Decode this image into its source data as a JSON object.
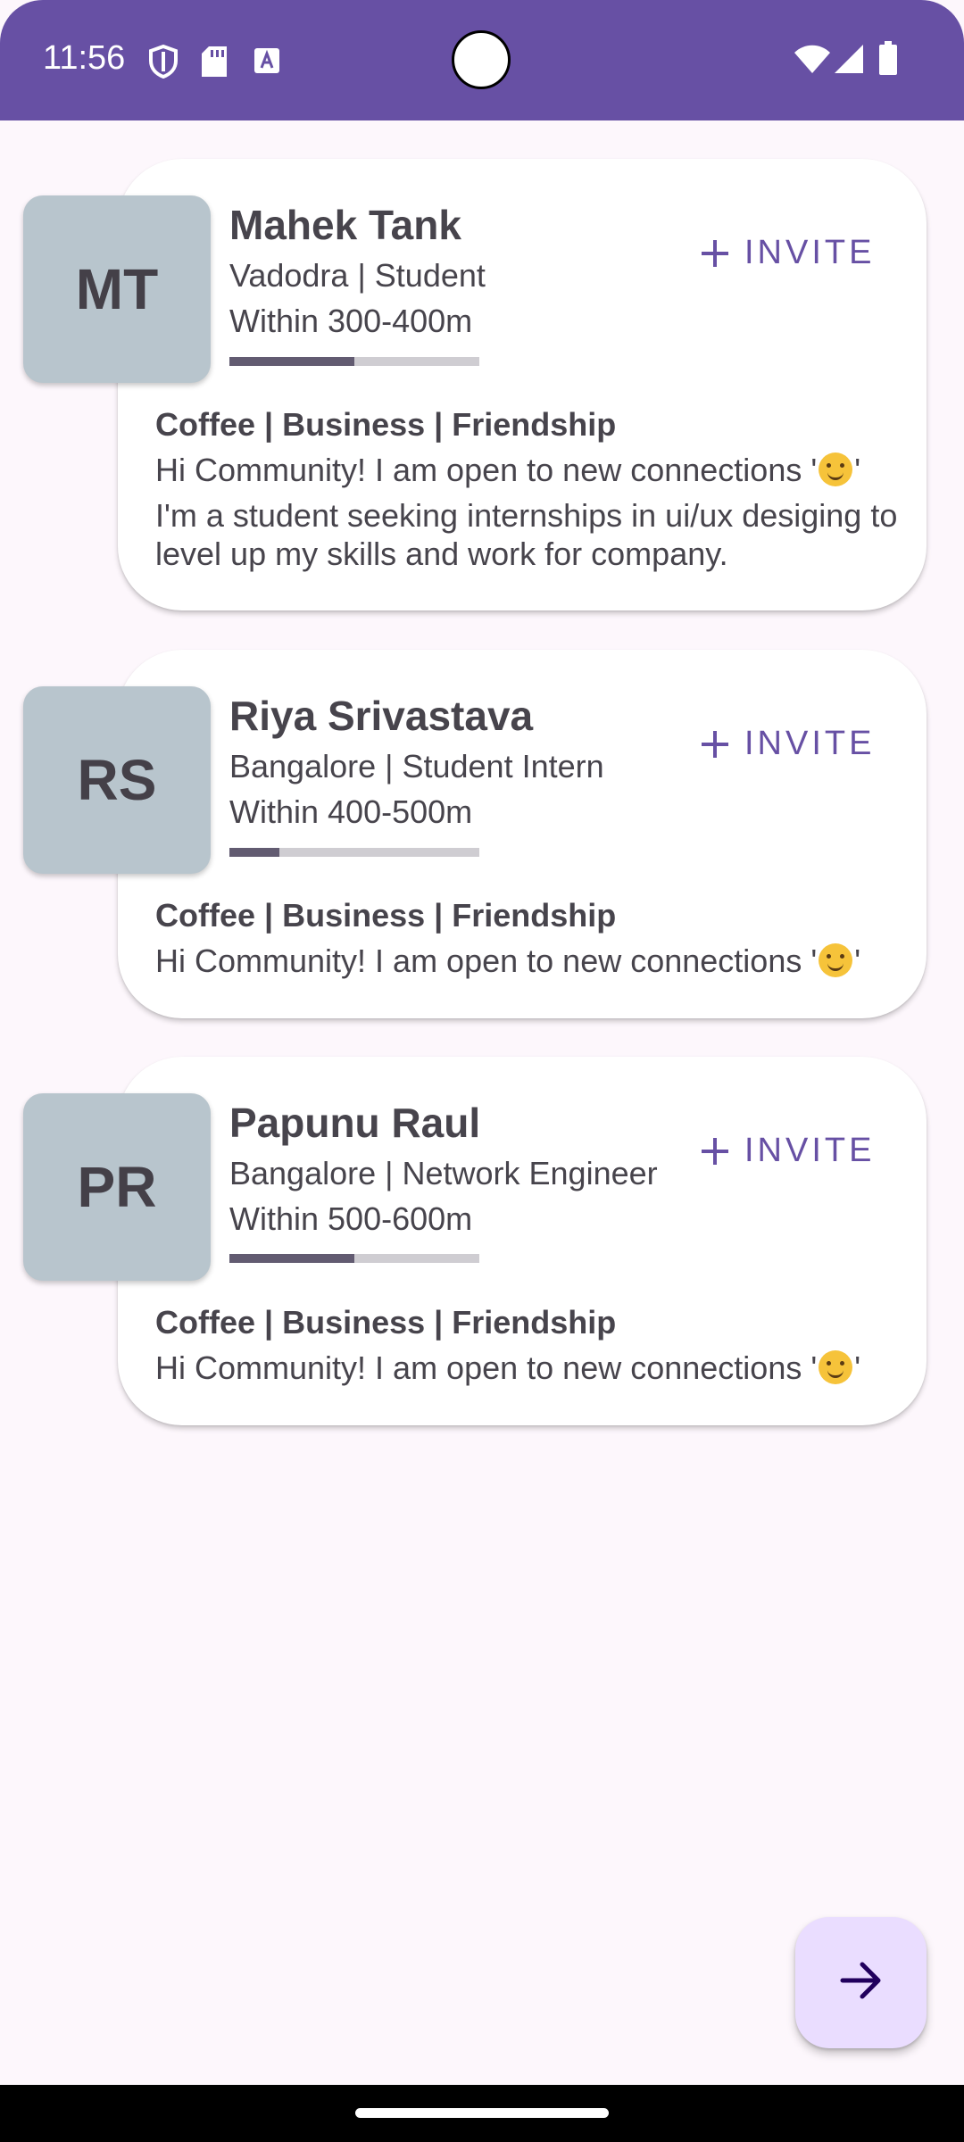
{
  "status_bar": {
    "time": "11:56",
    "icons": [
      "shield-icon",
      "sd-card-icon",
      "text-a-icon",
      "wifi-icon",
      "signal-icon",
      "battery-icon"
    ],
    "background_color": "#6750a4"
  },
  "cards": [
    {
      "initials": "MT",
      "name": "Mahek Tank",
      "location_role": "Vadodra | Student",
      "distance": "Within 300-400m",
      "proximity_fraction": 0.5,
      "invite_label": "INVITE",
      "interests": "Coffee | Business | Friendship",
      "bio_prefix": "Hi Community! I am open to new connections '",
      "bio_suffix": "'",
      "bio_extra": "I'm a student seeking internships in ui/ux desiging to level up my skills and work for company."
    },
    {
      "initials": "RS",
      "name": "Riya Srivastava",
      "location_role": "Bangalore | Student Intern",
      "distance": "Within 400-500m",
      "proximity_fraction": 0.2,
      "invite_label": "INVITE",
      "interests": "Coffee | Business | Friendship",
      "bio_prefix": "Hi Community! I am open to new connections '",
      "bio_suffix": "'"
    },
    {
      "initials": "PR",
      "name": "Papunu Raul",
      "location_role": "Bangalore | Network Engineer",
      "distance": "Within 500-600m",
      "proximity_fraction": 0.5,
      "invite_label": "INVITE",
      "interests": "Coffee | Business | Friendship",
      "bio_prefix": "Hi Community! I am open to new connections '",
      "bio_suffix": "'"
    }
  ],
  "fab": {
    "icon": "arrow-forward-icon",
    "background_color": "#eaddff"
  },
  "colors": {
    "accent": "#6750a4",
    "progress_fill": "#625b71",
    "avatar_bg": "#b8c5cd"
  }
}
